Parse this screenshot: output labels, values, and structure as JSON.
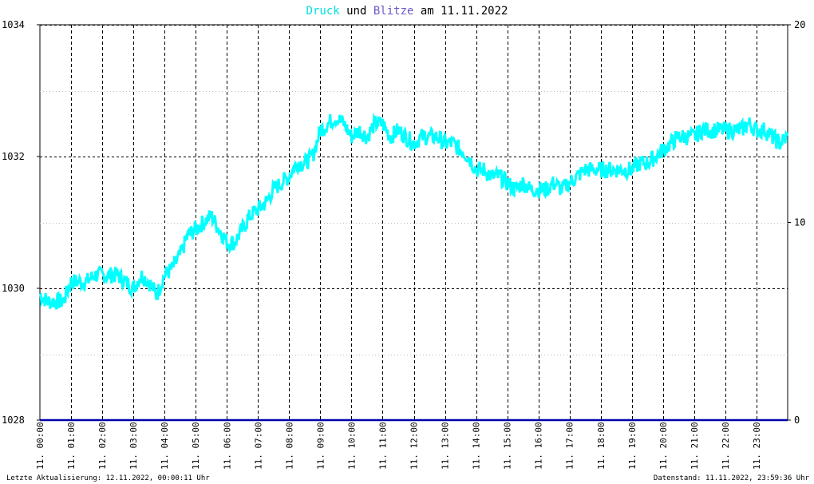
{
  "title": {
    "series1_label": "Druck",
    "connector": " und ",
    "series2_label": "Blitze",
    "date_prefix": " am ",
    "date": "11.11.2022"
  },
  "footer": {
    "left": "Letzte Aktualisierung: 12.11.2022, 00:00:11 Uhr",
    "right": "Datenstand: 11.11.2022, 23:59:36 Uhr"
  },
  "colors": {
    "pressure": "#00ffff",
    "lightning": "#0000aa",
    "title_druck": "#00e0e0",
    "title_blitze": "#6a5acd",
    "grid": "#000000"
  },
  "chart_data": {
    "type": "line",
    "title": "Druck und Blitze am 11.11.2022",
    "x_unit": "hours",
    "xlim": [
      0,
      24
    ],
    "x_tick_labels": [
      "11. 00:00",
      "11. 01:00",
      "11. 02:00",
      "11. 03:00",
      "11. 04:00",
      "11. 05:00",
      "11. 06:00",
      "11. 07:00",
      "11. 08:00",
      "11. 09:00",
      "11. 10:00",
      "11. 11:00",
      "11. 12:00",
      "11. 13:00",
      "11. 14:00",
      "11. 15:00",
      "11. 16:00",
      "11. 17:00",
      "11. 18:00",
      "11. 19:00",
      "11. 20:00",
      "11. 21:00",
      "11. 22:00",
      "11. 23:00"
    ],
    "y_left": {
      "ylim": [
        1028,
        1034
      ],
      "ticks": [
        1028,
        1030,
        1032,
        1034
      ],
      "minor_ticks": [
        1029,
        1031,
        1033
      ]
    },
    "y_right": {
      "ylim": [
        0,
        20
      ],
      "ticks": [
        0,
        10,
        20
      ]
    },
    "grid": true,
    "series": [
      {
        "name": "Druck",
        "axis": "left",
        "x": [
          0.0,
          0.25,
          0.5,
          0.75,
          1.0,
          1.25,
          1.5,
          1.75,
          2.0,
          2.25,
          2.5,
          2.75,
          3.0,
          3.25,
          3.5,
          3.75,
          4.0,
          4.25,
          4.5,
          4.75,
          5.0,
          5.25,
          5.5,
          5.75,
          6.0,
          6.25,
          6.5,
          6.75,
          7.0,
          7.25,
          7.5,
          7.75,
          8.0,
          8.25,
          8.5,
          8.75,
          9.0,
          9.25,
          9.5,
          9.75,
          10.0,
          10.25,
          10.5,
          10.75,
          11.0,
          11.25,
          11.5,
          11.75,
          12.0,
          12.25,
          12.5,
          12.75,
          13.0,
          13.25,
          13.5,
          13.75,
          14.0,
          14.25,
          14.5,
          14.75,
          15.0,
          15.25,
          15.5,
          15.75,
          16.0,
          16.25,
          16.5,
          16.75,
          17.0,
          17.25,
          17.5,
          17.75,
          18.0,
          18.25,
          18.5,
          18.75,
          19.0,
          19.25,
          19.5,
          19.75,
          20.0,
          20.25,
          20.5,
          20.75,
          21.0,
          21.25,
          21.5,
          21.75,
          22.0,
          22.25,
          22.5,
          22.75,
          23.0,
          23.25,
          23.5,
          23.75,
          24.0
        ],
        "values": [
          1029.9,
          1029.8,
          1029.8,
          1029.8,
          1030.1,
          1030.1,
          1030.1,
          1030.2,
          1030.2,
          1030.2,
          1030.2,
          1030.1,
          1030.0,
          1030.2,
          1030.1,
          1029.9,
          1030.2,
          1030.3,
          1030.5,
          1030.8,
          1030.9,
          1031.0,
          1031.1,
          1030.9,
          1030.7,
          1030.7,
          1030.9,
          1031.1,
          1031.2,
          1031.3,
          1031.5,
          1031.6,
          1031.7,
          1031.9,
          1031.9,
          1032.0,
          1032.4,
          1032.5,
          1032.6,
          1032.5,
          1032.3,
          1032.4,
          1032.3,
          1032.5,
          1032.5,
          1032.3,
          1032.4,
          1032.3,
          1032.2,
          1032.3,
          1032.3,
          1032.3,
          1032.2,
          1032.2,
          1032.1,
          1032.0,
          1031.8,
          1031.8,
          1031.7,
          1031.7,
          1031.6,
          1031.5,
          1031.6,
          1031.5,
          1031.5,
          1031.5,
          1031.6,
          1031.5,
          1031.6,
          1031.7,
          1031.8,
          1031.8,
          1031.8,
          1031.8,
          1031.8,
          1031.8,
          1031.8,
          1031.9,
          1031.9,
          1032.0,
          1032.1,
          1032.2,
          1032.3,
          1032.3,
          1032.3,
          1032.4,
          1032.4,
          1032.4,
          1032.4,
          1032.4,
          1032.4,
          1032.5,
          1032.4,
          1032.4,
          1032.3,
          1032.2,
          1032.3
        ]
      },
      {
        "name": "Blitze",
        "axis": "right",
        "x": [
          0,
          24
        ],
        "values": [
          0,
          0
        ]
      }
    ]
  }
}
